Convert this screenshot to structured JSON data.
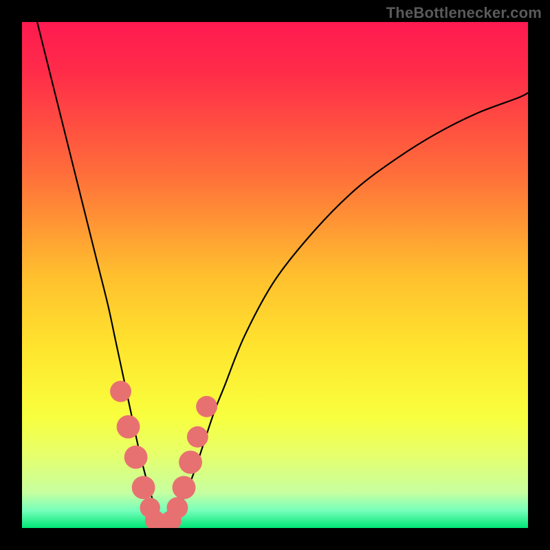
{
  "watermark": "TheBottlenecker.com",
  "colors": {
    "frame": "#000000",
    "curve": "#000000",
    "marker": "#e77171",
    "gradient_stops": [
      {
        "offset": 0.0,
        "color": "#ff1a50"
      },
      {
        "offset": 0.1,
        "color": "#ff2c49"
      },
      {
        "offset": 0.3,
        "color": "#ff6e3a"
      },
      {
        "offset": 0.5,
        "color": "#ffbf2e"
      },
      {
        "offset": 0.65,
        "color": "#ffe62e"
      },
      {
        "offset": 0.78,
        "color": "#f8ff3e"
      },
      {
        "offset": 0.85,
        "color": "#e8ff68"
      },
      {
        "offset": 0.93,
        "color": "#c7ffa0"
      },
      {
        "offset": 0.965,
        "color": "#77ffbb"
      },
      {
        "offset": 1.0,
        "color": "#00e676"
      }
    ]
  },
  "chart_data": {
    "type": "line",
    "title": "",
    "xlabel": "",
    "ylabel": "",
    "xlim": [
      0,
      100
    ],
    "ylim": [
      0,
      100
    ],
    "series": [
      {
        "name": "bottleneck-curve",
        "x": [
          3,
          5,
          7,
          9,
          11,
          13,
          15,
          17,
          18.5,
          20,
          21.5,
          23,
          24.5,
          26,
          27,
          28,
          29,
          30,
          32,
          34,
          36,
          38,
          40,
          44,
          50,
          58,
          66,
          74,
          82,
          90,
          98,
          100
        ],
        "values": [
          100,
          92,
          84,
          76,
          68,
          60,
          52,
          44,
          37,
          30,
          23,
          16,
          10,
          5,
          2,
          0.5,
          0.5,
          2,
          6,
          11,
          17,
          23,
          28,
          38,
          49,
          59,
          67,
          73,
          78,
          82,
          85,
          86
        ]
      }
    ],
    "markers": [
      {
        "x": 19.5,
        "y": 27,
        "r": 2.1
      },
      {
        "x": 21.0,
        "y": 20,
        "r": 2.3
      },
      {
        "x": 22.5,
        "y": 14,
        "r": 2.3
      },
      {
        "x": 24.0,
        "y": 8,
        "r": 2.3
      },
      {
        "x": 25.3,
        "y": 4,
        "r": 2.0
      },
      {
        "x": 26.3,
        "y": 1.5,
        "r": 2.0
      },
      {
        "x": 27.3,
        "y": 0.5,
        "r": 2.0
      },
      {
        "x": 28.3,
        "y": 0.5,
        "r": 2.0
      },
      {
        "x": 29.5,
        "y": 1.5,
        "r": 2.0
      },
      {
        "x": 30.7,
        "y": 4,
        "r": 2.1
      },
      {
        "x": 32.0,
        "y": 8,
        "r": 2.3
      },
      {
        "x": 33.3,
        "y": 13,
        "r": 2.3
      },
      {
        "x": 34.7,
        "y": 18,
        "r": 2.1
      },
      {
        "x": 36.5,
        "y": 24,
        "r": 2.1
      }
    ]
  }
}
